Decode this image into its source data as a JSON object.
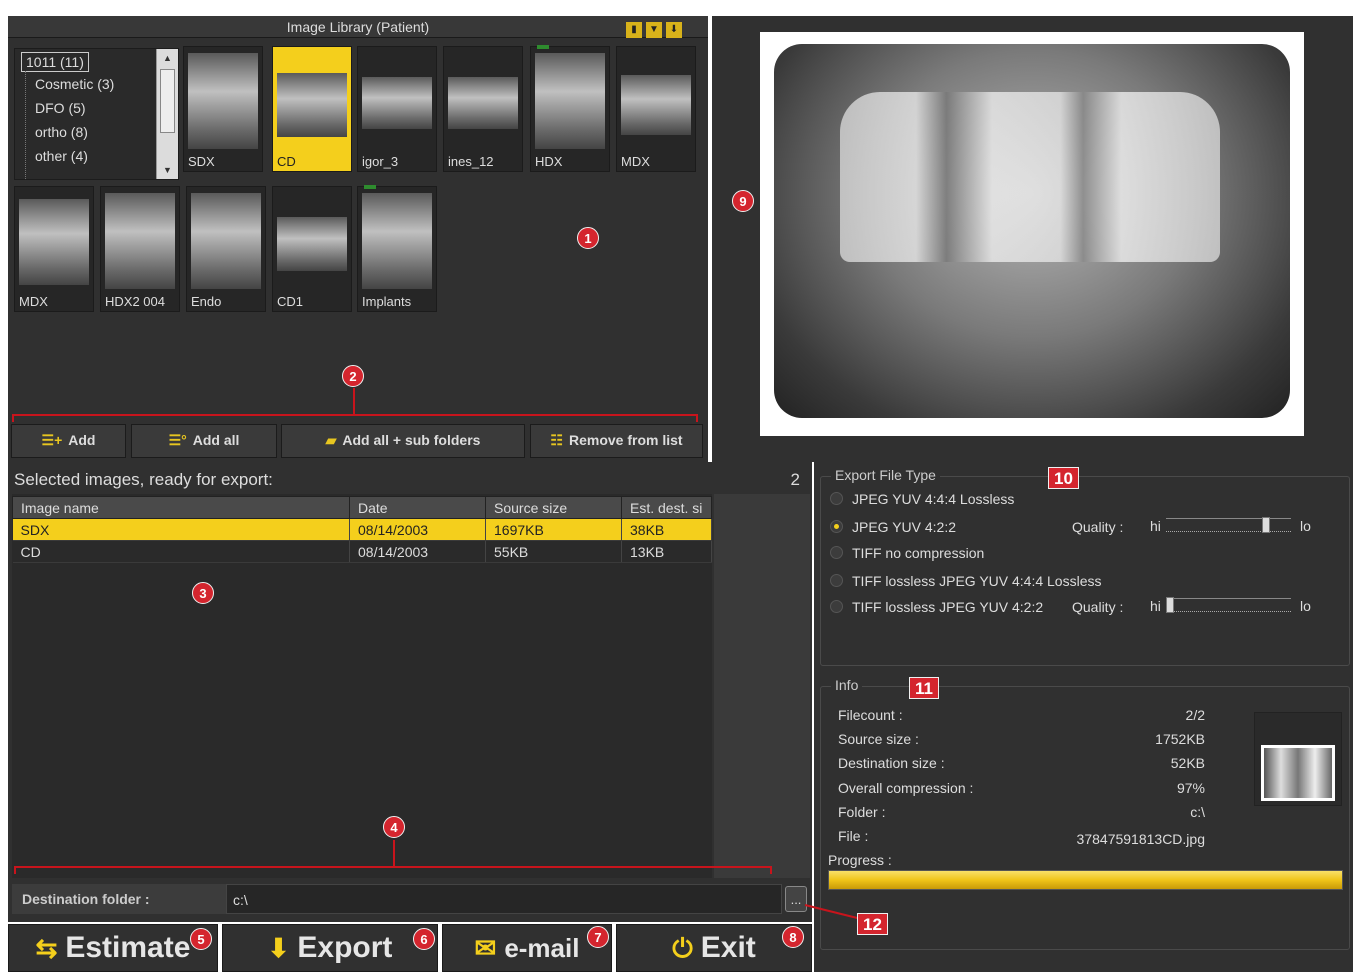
{
  "library": {
    "title": "Image Library (Patient)",
    "header_icons": [
      "trash-icon",
      "filter-icon",
      "download-icon"
    ],
    "tree": [
      "1011 (11)",
      "Cosmetic (3)",
      "DFO (5)",
      "ortho (8)",
      "other (4)"
    ],
    "thumbs": [
      {
        "label": "SDX"
      },
      {
        "label": "CD",
        "selected": true
      },
      {
        "label": "igor_3"
      },
      {
        "label": "ines_12"
      },
      {
        "label": "HDX"
      },
      {
        "label": "MDX"
      },
      {
        "label": "MDX"
      },
      {
        "label": "HDX2 004"
      },
      {
        "label": "Endo"
      },
      {
        "label": "CD1"
      },
      {
        "label": "Implants"
      }
    ]
  },
  "buttons": {
    "add": "Add",
    "add_all": "Add all",
    "add_sub": "Add all + sub folders",
    "remove": "Remove from list"
  },
  "selected": {
    "title": "Selected images, ready for export:",
    "count": "2",
    "columns": [
      "Image name",
      "Date",
      "Source size",
      "Est. dest. si"
    ],
    "rows": [
      [
        "SDX",
        "08/14/2003",
        "1697KB",
        "38KB"
      ],
      [
        "CD",
        "08/14/2003",
        "55KB",
        "13KB"
      ]
    ]
  },
  "destination": {
    "label": "Destination folder :",
    "value": "c:\\",
    "browse": "..."
  },
  "actions": {
    "estimate": "Estimate",
    "export": "Export",
    "email": "e-mail",
    "exit": "Exit"
  },
  "export_type": {
    "legend": "Export File Type",
    "options": [
      "JPEG YUV 4:4:4 Lossless",
      "JPEG YUV 4:2:2",
      "TIFF no compression",
      "TIFF lossless JPEG YUV 4:4:4 Lossless",
      "TIFF lossless JPEG YUV 4:2:2"
    ],
    "selected_index": 1,
    "quality_label": "Quality :",
    "hi": "hi",
    "lo": "lo",
    "quality1": 0.8,
    "quality2": 0.0
  },
  "info": {
    "legend": "Info",
    "rows": [
      [
        "Filecount :",
        "2/2"
      ],
      [
        "Source size :",
        "1752KB"
      ],
      [
        "Destination size :",
        "52KB"
      ],
      [
        "Overall compression :",
        "97%"
      ],
      [
        "Folder :",
        "c:\\"
      ],
      [
        "File :",
        "37847591813CD.jpg"
      ]
    ],
    "progress_label": "Progress :",
    "progress": 1.0
  },
  "markers": [
    "1",
    "2",
    "3",
    "4",
    "5",
    "6",
    "7",
    "8",
    "9",
    "10",
    "11",
    "12"
  ],
  "colors": {
    "accent": "#f4cf1c",
    "marker": "#d4252e",
    "panel": "#303030"
  }
}
